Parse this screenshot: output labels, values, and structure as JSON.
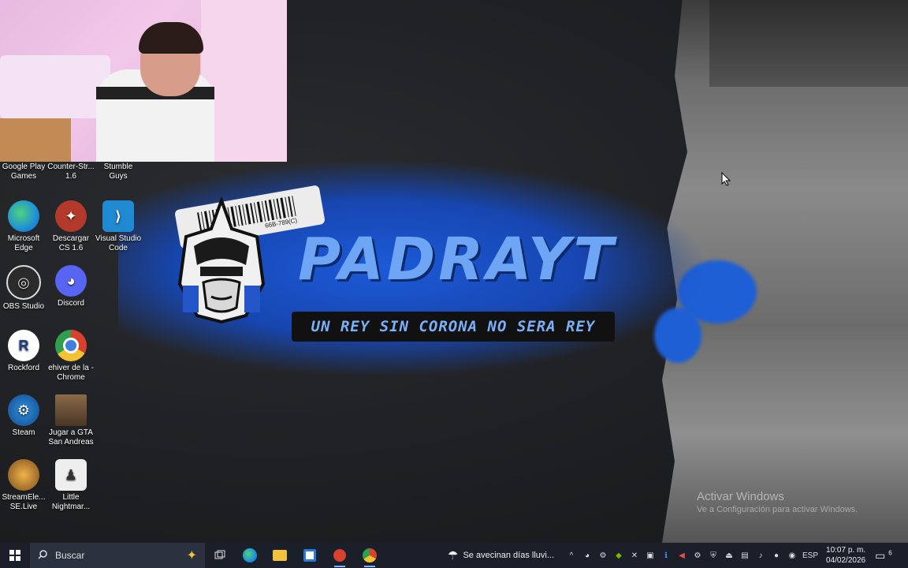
{
  "desktop": {
    "icons": [
      {
        "label": "Google Play Games",
        "icon": "google-play-games-icon",
        "color": "#3a8f3d"
      },
      {
        "label": "Counter-Str... 1.6",
        "icon": "counter-strike-icon",
        "color": "#6b4e2e"
      },
      {
        "label": "Stumble Guys",
        "icon": "stumble-guys-icon",
        "color": "#3b6ad6"
      },
      {
        "label": "Microsoft Edge",
        "icon": "edge-icon",
        "color": "#1e8fd8"
      },
      {
        "label": "Descargar CS 1.6",
        "icon": "counter-strike-icon",
        "color": "#b33a2a"
      },
      {
        "label": "Visual Studio Code",
        "icon": "vscode-icon",
        "color": "#1f8ad2"
      },
      {
        "label": "OBS Studio",
        "icon": "obs-icon",
        "color": "#2b2b2b"
      },
      {
        "label": "Discord",
        "icon": "discord-icon",
        "color": "#5865f2"
      },
      {
        "label": "Rockford",
        "icon": "rockford-icon",
        "color": "#1e3f8a"
      },
      {
        "label": "ehiver de la - Chrome",
        "icon": "chrome-icon",
        "color": "#d9412f"
      },
      {
        "label": "Steam",
        "icon": "steam-icon",
        "color": "#1b74c4"
      },
      {
        "label": "Jugar a GTA San Andreas",
        "icon": "gta-icon",
        "color": "#7b5a3a"
      },
      {
        "label": "StreamEle... SE.Live",
        "icon": "streamelements-icon",
        "color": "#d38b2d"
      },
      {
        "label": "Little Nightmar...",
        "icon": "little-nightmares-icon",
        "color": "#333333"
      }
    ]
  },
  "banner": {
    "title": "PADRAYT",
    "subtitle": "UN REY SIN CORONA NO SERA REY",
    "barcode_text": "66B-789(C)"
  },
  "watermark": {
    "line1": "Activar Windows",
    "line2": "Ve a Configuración para activar Windows."
  },
  "taskbar": {
    "search_placeholder": "Buscar",
    "weather_text": "Se avecinan días lluvi...",
    "language": "ESP",
    "time": "10:07 p. m.",
    "date": "04/02/2026",
    "notification_count": "6",
    "accent": "#7fb3ff"
  }
}
